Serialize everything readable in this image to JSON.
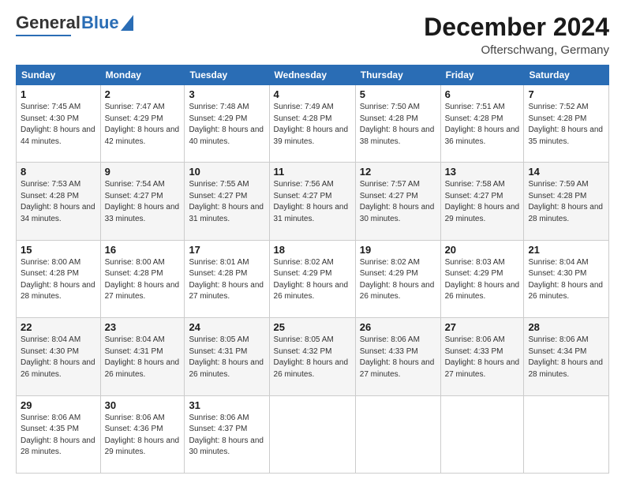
{
  "header": {
    "logo_general": "General",
    "logo_blue": "Blue",
    "month_year": "December 2024",
    "location": "Ofterschwang, Germany"
  },
  "days_of_week": [
    "Sunday",
    "Monday",
    "Tuesday",
    "Wednesday",
    "Thursday",
    "Friday",
    "Saturday"
  ],
  "weeks": [
    [
      {
        "day": "1",
        "sunrise": "Sunrise: 7:45 AM",
        "sunset": "Sunset: 4:30 PM",
        "daylight": "Daylight: 8 hours and 44 minutes."
      },
      {
        "day": "2",
        "sunrise": "Sunrise: 7:47 AM",
        "sunset": "Sunset: 4:29 PM",
        "daylight": "Daylight: 8 hours and 42 minutes."
      },
      {
        "day": "3",
        "sunrise": "Sunrise: 7:48 AM",
        "sunset": "Sunset: 4:29 PM",
        "daylight": "Daylight: 8 hours and 40 minutes."
      },
      {
        "day": "4",
        "sunrise": "Sunrise: 7:49 AM",
        "sunset": "Sunset: 4:28 PM",
        "daylight": "Daylight: 8 hours and 39 minutes."
      },
      {
        "day": "5",
        "sunrise": "Sunrise: 7:50 AM",
        "sunset": "Sunset: 4:28 PM",
        "daylight": "Daylight: 8 hours and 38 minutes."
      },
      {
        "day": "6",
        "sunrise": "Sunrise: 7:51 AM",
        "sunset": "Sunset: 4:28 PM",
        "daylight": "Daylight: 8 hours and 36 minutes."
      },
      {
        "day": "7",
        "sunrise": "Sunrise: 7:52 AM",
        "sunset": "Sunset: 4:28 PM",
        "daylight": "Daylight: 8 hours and 35 minutes."
      }
    ],
    [
      {
        "day": "8",
        "sunrise": "Sunrise: 7:53 AM",
        "sunset": "Sunset: 4:28 PM",
        "daylight": "Daylight: 8 hours and 34 minutes."
      },
      {
        "day": "9",
        "sunrise": "Sunrise: 7:54 AM",
        "sunset": "Sunset: 4:27 PM",
        "daylight": "Daylight: 8 hours and 33 minutes."
      },
      {
        "day": "10",
        "sunrise": "Sunrise: 7:55 AM",
        "sunset": "Sunset: 4:27 PM",
        "daylight": "Daylight: 8 hours and 31 minutes."
      },
      {
        "day": "11",
        "sunrise": "Sunrise: 7:56 AM",
        "sunset": "Sunset: 4:27 PM",
        "daylight": "Daylight: 8 hours and 31 minutes."
      },
      {
        "day": "12",
        "sunrise": "Sunrise: 7:57 AM",
        "sunset": "Sunset: 4:27 PM",
        "daylight": "Daylight: 8 hours and 30 minutes."
      },
      {
        "day": "13",
        "sunrise": "Sunrise: 7:58 AM",
        "sunset": "Sunset: 4:27 PM",
        "daylight": "Daylight: 8 hours and 29 minutes."
      },
      {
        "day": "14",
        "sunrise": "Sunrise: 7:59 AM",
        "sunset": "Sunset: 4:28 PM",
        "daylight": "Daylight: 8 hours and 28 minutes."
      }
    ],
    [
      {
        "day": "15",
        "sunrise": "Sunrise: 8:00 AM",
        "sunset": "Sunset: 4:28 PM",
        "daylight": "Daylight: 8 hours and 28 minutes."
      },
      {
        "day": "16",
        "sunrise": "Sunrise: 8:00 AM",
        "sunset": "Sunset: 4:28 PM",
        "daylight": "Daylight: 8 hours and 27 minutes."
      },
      {
        "day": "17",
        "sunrise": "Sunrise: 8:01 AM",
        "sunset": "Sunset: 4:28 PM",
        "daylight": "Daylight: 8 hours and 27 minutes."
      },
      {
        "day": "18",
        "sunrise": "Sunrise: 8:02 AM",
        "sunset": "Sunset: 4:29 PM",
        "daylight": "Daylight: 8 hours and 26 minutes."
      },
      {
        "day": "19",
        "sunrise": "Sunrise: 8:02 AM",
        "sunset": "Sunset: 4:29 PM",
        "daylight": "Daylight: 8 hours and 26 minutes."
      },
      {
        "day": "20",
        "sunrise": "Sunrise: 8:03 AM",
        "sunset": "Sunset: 4:29 PM",
        "daylight": "Daylight: 8 hours and 26 minutes."
      },
      {
        "day": "21",
        "sunrise": "Sunrise: 8:04 AM",
        "sunset": "Sunset: 4:30 PM",
        "daylight": "Daylight: 8 hours and 26 minutes."
      }
    ],
    [
      {
        "day": "22",
        "sunrise": "Sunrise: 8:04 AM",
        "sunset": "Sunset: 4:30 PM",
        "daylight": "Daylight: 8 hours and 26 minutes."
      },
      {
        "day": "23",
        "sunrise": "Sunrise: 8:04 AM",
        "sunset": "Sunset: 4:31 PM",
        "daylight": "Daylight: 8 hours and 26 minutes."
      },
      {
        "day": "24",
        "sunrise": "Sunrise: 8:05 AM",
        "sunset": "Sunset: 4:31 PM",
        "daylight": "Daylight: 8 hours and 26 minutes."
      },
      {
        "day": "25",
        "sunrise": "Sunrise: 8:05 AM",
        "sunset": "Sunset: 4:32 PM",
        "daylight": "Daylight: 8 hours and 26 minutes."
      },
      {
        "day": "26",
        "sunrise": "Sunrise: 8:06 AM",
        "sunset": "Sunset: 4:33 PM",
        "daylight": "Daylight: 8 hours and 27 minutes."
      },
      {
        "day": "27",
        "sunrise": "Sunrise: 8:06 AM",
        "sunset": "Sunset: 4:33 PM",
        "daylight": "Daylight: 8 hours and 27 minutes."
      },
      {
        "day": "28",
        "sunrise": "Sunrise: 8:06 AM",
        "sunset": "Sunset: 4:34 PM",
        "daylight": "Daylight: 8 hours and 28 minutes."
      }
    ],
    [
      {
        "day": "29",
        "sunrise": "Sunrise: 8:06 AM",
        "sunset": "Sunset: 4:35 PM",
        "daylight": "Daylight: 8 hours and 28 minutes."
      },
      {
        "day": "30",
        "sunrise": "Sunrise: 8:06 AM",
        "sunset": "Sunset: 4:36 PM",
        "daylight": "Daylight: 8 hours and 29 minutes."
      },
      {
        "day": "31",
        "sunrise": "Sunrise: 8:06 AM",
        "sunset": "Sunset: 4:37 PM",
        "daylight": "Daylight: 8 hours and 30 minutes."
      },
      null,
      null,
      null,
      null
    ]
  ]
}
